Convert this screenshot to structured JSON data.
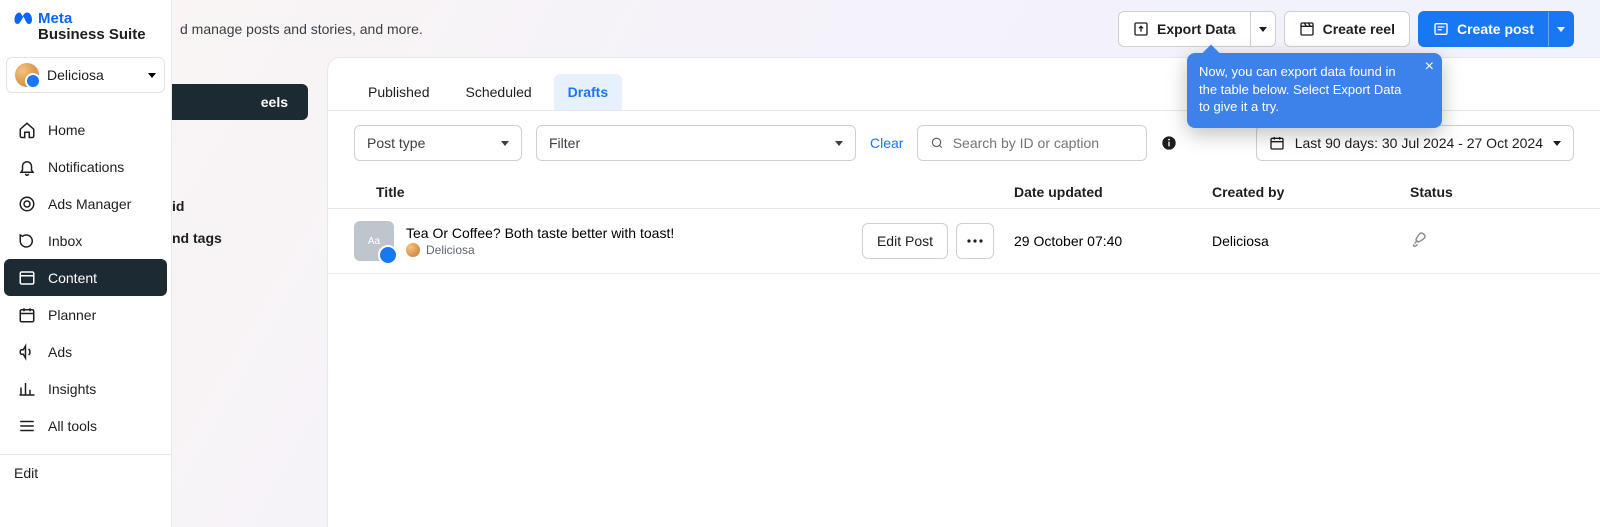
{
  "brand": {
    "line1": "Meta",
    "line2": "Business Suite"
  },
  "account": {
    "name": "Deliciosa"
  },
  "sidebar": {
    "items": [
      {
        "label": "Home"
      },
      {
        "label": "Notifications"
      },
      {
        "label": "Ads Manager"
      },
      {
        "label": "Inbox"
      },
      {
        "label": "Content"
      },
      {
        "label": "Planner"
      },
      {
        "label": "Ads"
      },
      {
        "label": "Insights"
      },
      {
        "label": "All tools"
      }
    ],
    "edit": "Edit"
  },
  "subnav": {
    "active": "eels",
    "line_grid": "id",
    "line_tags": "nd tags"
  },
  "header": {
    "crumb_fragment": "d manage posts and stories, and more.",
    "export": "Export Data",
    "reel": "Create reel",
    "post": "Create post"
  },
  "callout": {
    "text": "Now, you can export data found in the table below. Select Export Data to give it a try."
  },
  "tabs": [
    {
      "label": "Published"
    },
    {
      "label": "Scheduled"
    },
    {
      "label": "Drafts"
    }
  ],
  "filters": {
    "post_type": "Post type",
    "filter": "Filter",
    "clear": "Clear",
    "search_placeholder": "Search by ID or caption",
    "daterange": "Last 90 days: 30 Jul 2024 - 27 Oct 2024"
  },
  "columns": {
    "title": "Title",
    "date": "Date updated",
    "by": "Created by",
    "status": "Status"
  },
  "rows": [
    {
      "title": "Tea Or Coffee? Both taste better with toast!",
      "page": "Deliciosa",
      "edit": "Edit Post",
      "date": "29 October 07:40",
      "by": "Deliciosa"
    }
  ]
}
